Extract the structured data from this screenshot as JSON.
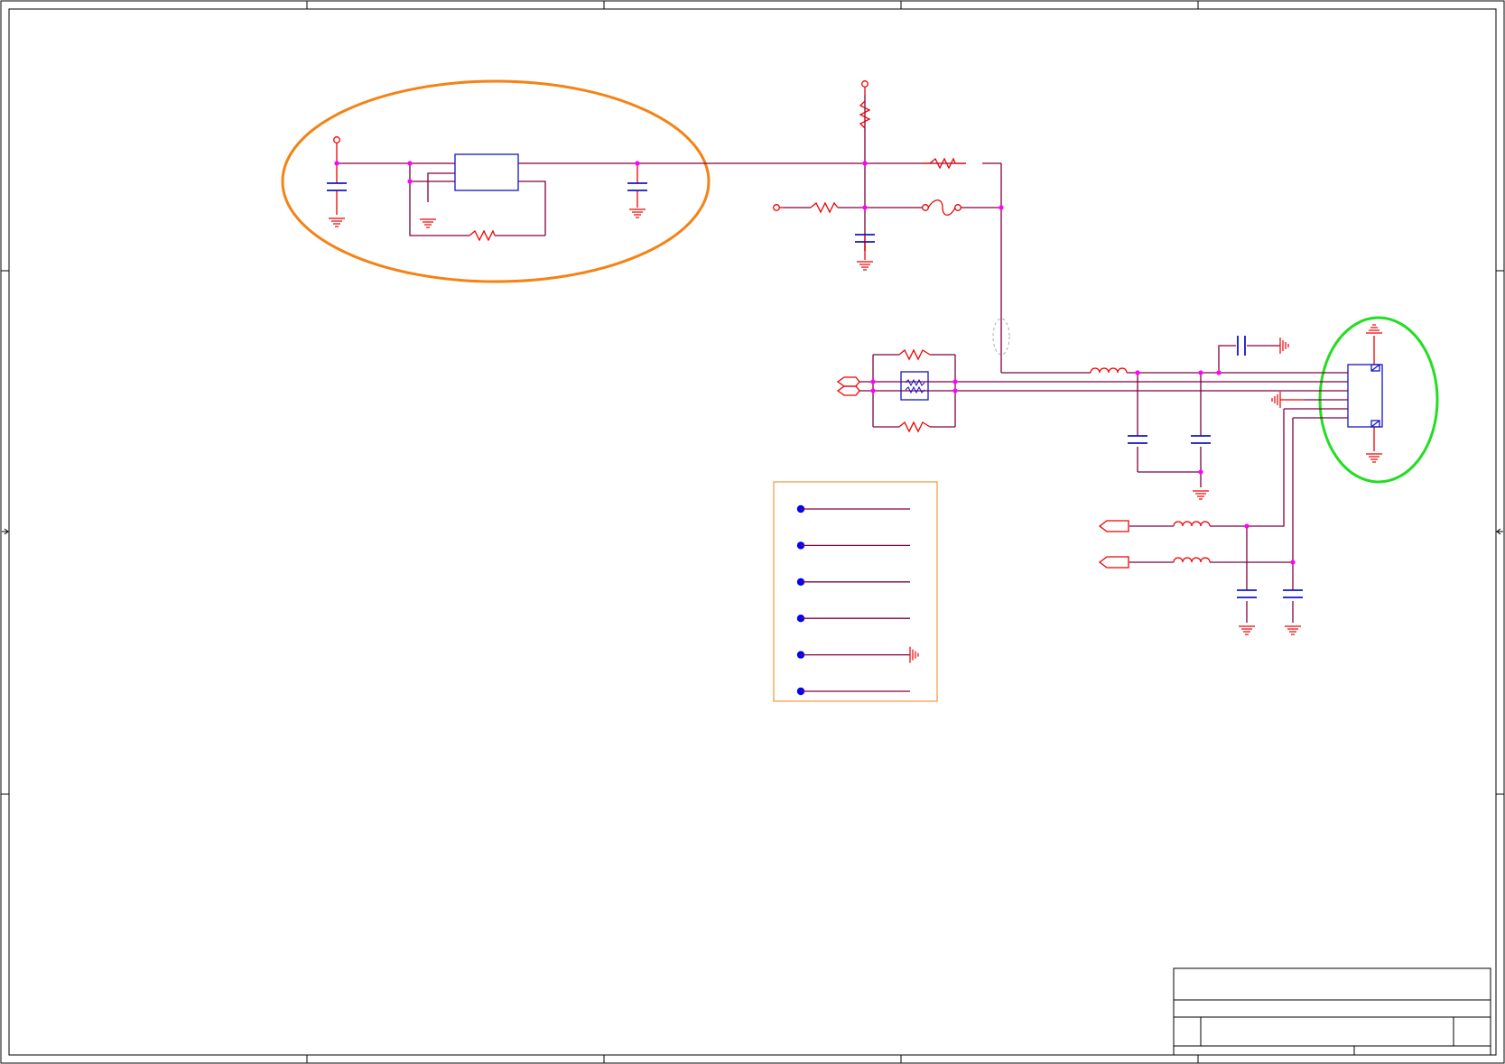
{
  "document": {
    "kind": "schematic-sheet",
    "title_block": {
      "title": "",
      "document_number": "",
      "revision": "",
      "sheet": ""
    }
  },
  "colors": {
    "background": "#ffffff",
    "border": "#000000",
    "net_wire": "#800040",
    "component": "#ee0000",
    "ic_body": "#1414c8",
    "junction": "#ff00ff",
    "highlight_regulator": "#f58214",
    "highlight_connector": "#22dd22",
    "legend_frame": "#f58214",
    "legend_pin": "#0000ff"
  },
  "highlights": [
    {
      "target": "regulator-section",
      "shape": "ellipse",
      "color": "orange"
    },
    {
      "target": "connector-section",
      "shape": "ellipse",
      "color": "green"
    }
  ],
  "legend": {
    "entries": 6,
    "ground_entry_index": 4
  }
}
